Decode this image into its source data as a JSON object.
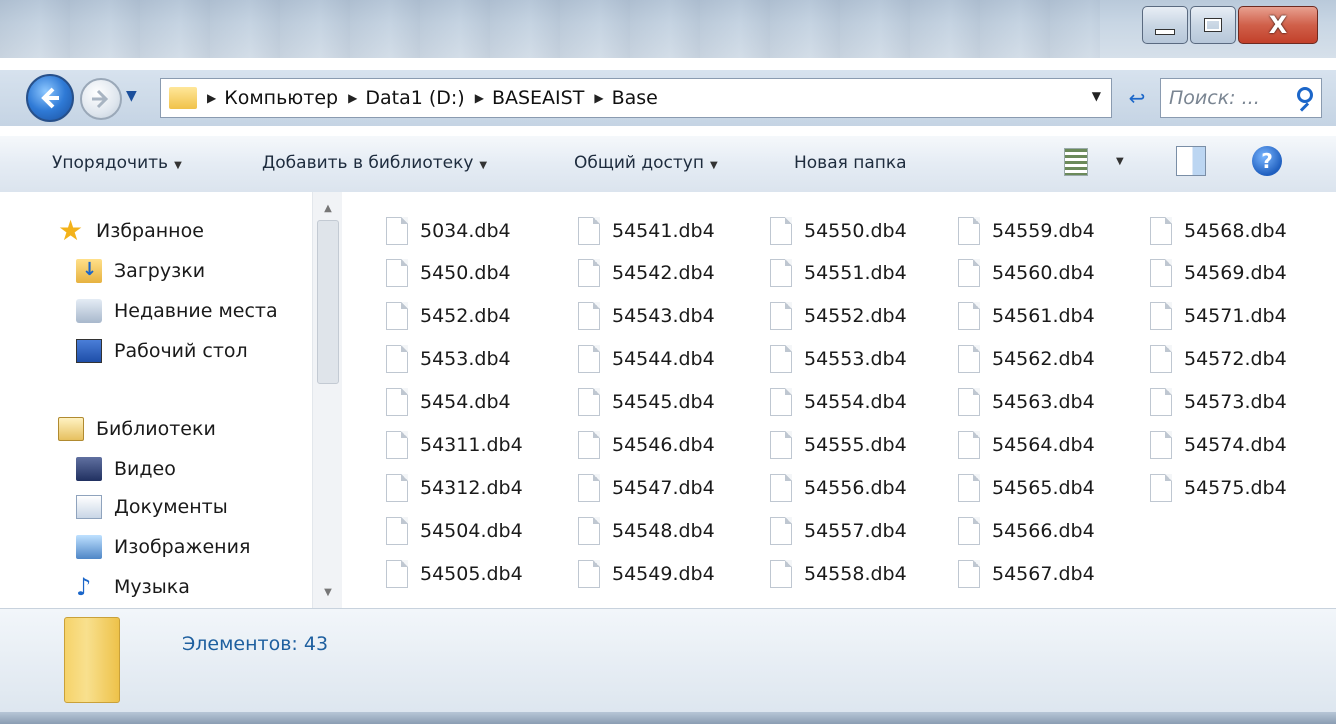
{
  "window": {
    "close_glyph": "X"
  },
  "nav": {
    "path": [
      "Компьютер",
      "Data1 (D:)",
      "BASEAIST",
      "Base"
    ],
    "search_placeholder": "Поиск: ...",
    "refresh_glyph": "↩"
  },
  "toolbar": {
    "organize": "Упорядочить",
    "add_library": "Добавить в библиотеку",
    "share": "Общий доступ",
    "new_folder": "Новая папка",
    "help": "?"
  },
  "sidebar": {
    "favorites": "Избранное",
    "downloads": "Загрузки",
    "recent": "Недавние места",
    "desktop": "Рабочий стол",
    "libraries": "Библиотеки",
    "video": "Видео",
    "documents": "Документы",
    "images": "Изображения",
    "music": "Музыка"
  },
  "files": [
    [
      "5034.db4",
      "5450.db4",
      "5452.db4",
      "5453.db4",
      "5454.db4",
      "54311.db4",
      "54312.db4",
      "54504.db4",
      "54505.db4"
    ],
    [
      "54541.db4",
      "54542.db4",
      "54543.db4",
      "54544.db4",
      "54545.db4",
      "54546.db4",
      "54547.db4",
      "54548.db4",
      "54549.db4"
    ],
    [
      "54550.db4",
      "54551.db4",
      "54552.db4",
      "54553.db4",
      "54554.db4",
      "54555.db4",
      "54556.db4",
      "54557.db4",
      "54558.db4"
    ],
    [
      "54559.db4",
      "54560.db4",
      "54561.db4",
      "54562.db4",
      "54563.db4",
      "54564.db4",
      "54565.db4",
      "54566.db4",
      "54567.db4"
    ],
    [
      "54568.db4",
      "54569.db4",
      "54571.db4",
      "54572.db4",
      "54573.db4",
      "54574.db4",
      "54575.db4"
    ]
  ],
  "status": {
    "count_text": "Элементов: 43"
  },
  "colors": {
    "link_blue": "#1e5f9f",
    "accent_blue": "#1b66c9"
  }
}
